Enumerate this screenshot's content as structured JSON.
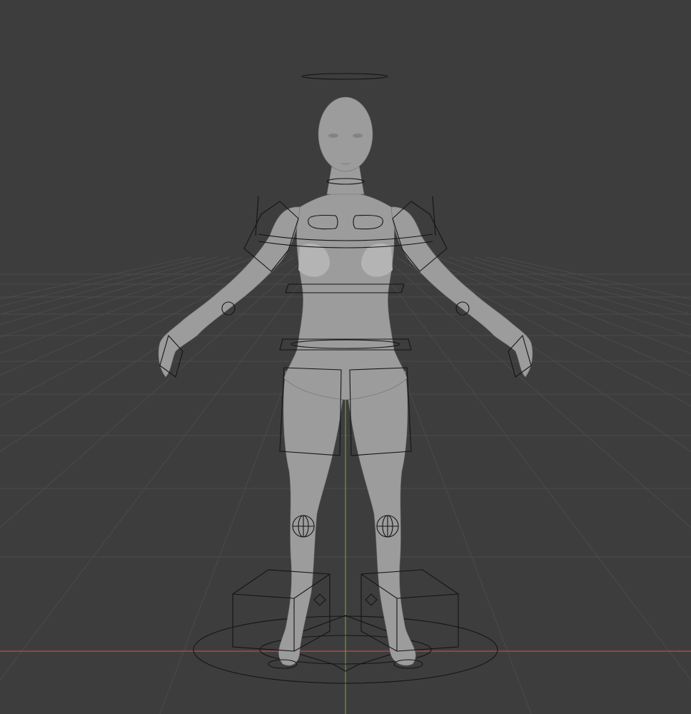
{
  "viewport": {
    "background_color": "#3d3d3d",
    "grid_color": "#4b4b4b",
    "x_axis_color": "#c14a4f",
    "y_axis_color": "#6e9a3a",
    "mesh_color": "#9c9c9c",
    "rig_color": "#141414"
  },
  "scene": {
    "object": "humanoid-mesh",
    "rig_controls": [
      "head-halo-control",
      "neck-control",
      "chest-controls",
      "shoulder-controls",
      "spine-controls",
      "hip-controls",
      "knee-pole-controls",
      "foot-ik-controls",
      "root-circle-control"
    ]
  }
}
